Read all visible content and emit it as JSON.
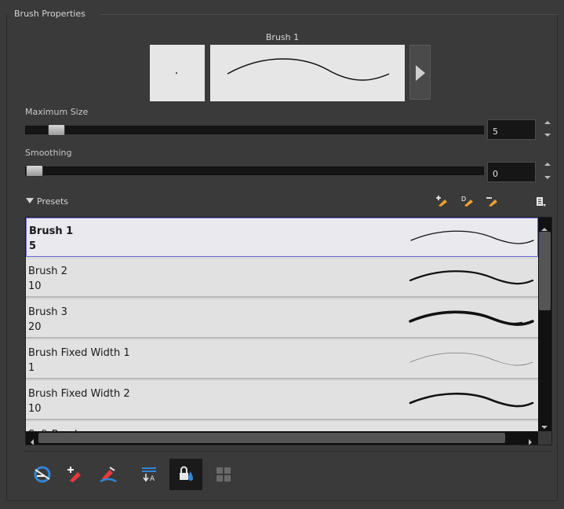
{
  "panel": {
    "title": "Brush Properties"
  },
  "preview": {
    "brush_name": "Brush 1"
  },
  "max_size": {
    "label": "Maximum Size",
    "value": "5",
    "slider_fraction": 0.05
  },
  "smoothing": {
    "label": "Smoothing",
    "value": "0",
    "slider_fraction": 0.0
  },
  "presets": {
    "label": "Presets",
    "icons": [
      "new-preset-icon",
      "rename-preset-icon",
      "delete-preset-icon",
      "presets-menu-icon"
    ],
    "items": [
      {
        "name": "Brush 1",
        "size": "5",
        "selected": true
      },
      {
        "name": "Brush 2",
        "size": "10",
        "selected": false
      },
      {
        "name": "Brush 3",
        "size": "20",
        "selected": false
      },
      {
        "name": "Brush Fixed Width 1",
        "size": "1",
        "selected": false
      },
      {
        "name": "Brush Fixed Width 2",
        "size": "10",
        "selected": false
      },
      {
        "name": "Soft Brush",
        "size": "",
        "selected": false
      }
    ]
  },
  "bottom_tools": [
    {
      "icon": "auto-flatten-icon",
      "active": false
    },
    {
      "icon": "draw-behind-icon",
      "active": false
    },
    {
      "icon": "auto-create-color-art-icon",
      "active": false
    },
    {
      "icon": "auto-close-gap-icon",
      "active": false
    },
    {
      "icon": "respect-protected-colour-icon",
      "active": true
    },
    {
      "icon": "grid-icon",
      "active": false
    }
  ],
  "colors": {
    "accent": "#6a6ad6",
    "icon_blue": "#2f86d6",
    "icon_red": "#e8393a",
    "icon_orange": "#f0a030"
  }
}
